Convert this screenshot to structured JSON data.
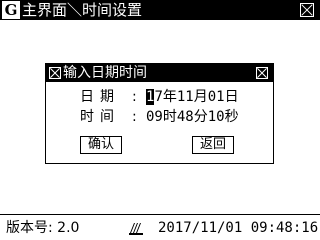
{
  "window": {
    "logo_glyph": "G",
    "title": "主界面＼时间设置"
  },
  "dialog": {
    "title": "输入日期时间",
    "date": {
      "label": "日期",
      "colon": ":",
      "year_cursor": "1",
      "year_rest": "7",
      "year_unit": "年",
      "month": "11",
      "month_unit": "月",
      "day": "01",
      "day_unit": "日"
    },
    "time": {
      "label": "时间",
      "colon": ":",
      "hour": "09",
      "hour_unit": "时",
      "minute": "48",
      "minute_unit": "分",
      "second": "10",
      "second_unit": "秒"
    },
    "ok_label": "确认",
    "back_label": "返回"
  },
  "status": {
    "version": "版本号: 2.0",
    "datetime": "2017/11/01 09:48:16",
    "comm_icon": "comm-signal-icon"
  }
}
